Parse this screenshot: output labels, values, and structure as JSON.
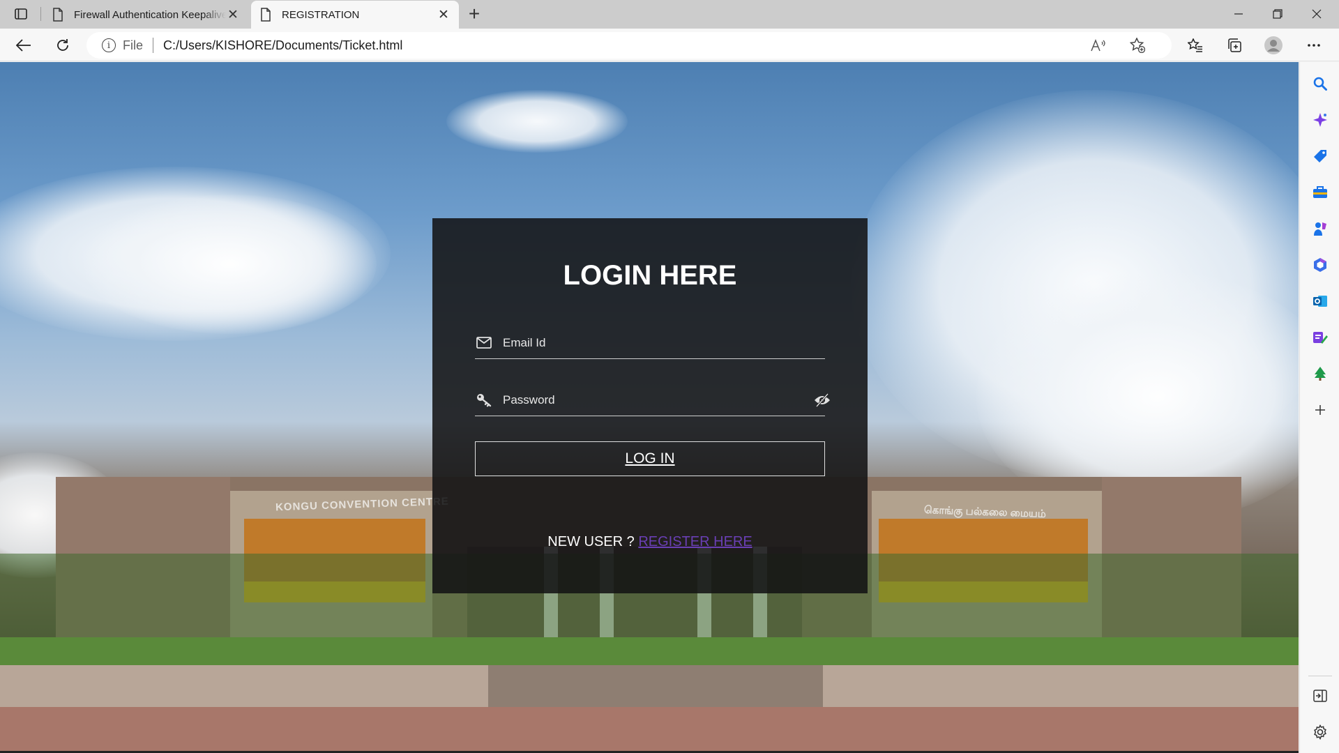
{
  "browser": {
    "tabs": [
      {
        "title": "Firewall Authentication Keepalive Window",
        "active": false
      },
      {
        "title": "REGISTRATION",
        "active": true
      }
    ],
    "address": {
      "scheme_label": "File",
      "url": "C:/Users/KISHORE/Documents/Ticket.html"
    },
    "toolbar_icons": [
      "back-icon",
      "refresh-icon",
      "read-aloud-icon",
      "add-favorite-icon",
      "favorites-icon",
      "collections-icon",
      "profile-icon",
      "more-icon"
    ],
    "sidebar_icons": [
      "search-icon",
      "copilot-icon",
      "shopping-icon",
      "tools-icon",
      "games-icon",
      "office-icon",
      "outlook-icon",
      "designer-icon",
      "tree-icon",
      "add-icon",
      "hide-sidebar-icon",
      "settings-icon"
    ]
  },
  "page": {
    "background_sign_left": "KONGU CONVENTION CENTRE",
    "background_sign_right": "கொங்கு பல்கலை மையம்",
    "login": {
      "title": "LOGIN HERE",
      "email_placeholder": "Email Id",
      "password_placeholder": "Password",
      "button_label": "LOG IN",
      "new_user_text": "NEW USER ?",
      "register_link": "REGISTER HERE"
    }
  },
  "colors": {
    "panel_bg": "#121214",
    "link": "#6a3fb5",
    "sidebar_accent": "#1a73e8"
  }
}
